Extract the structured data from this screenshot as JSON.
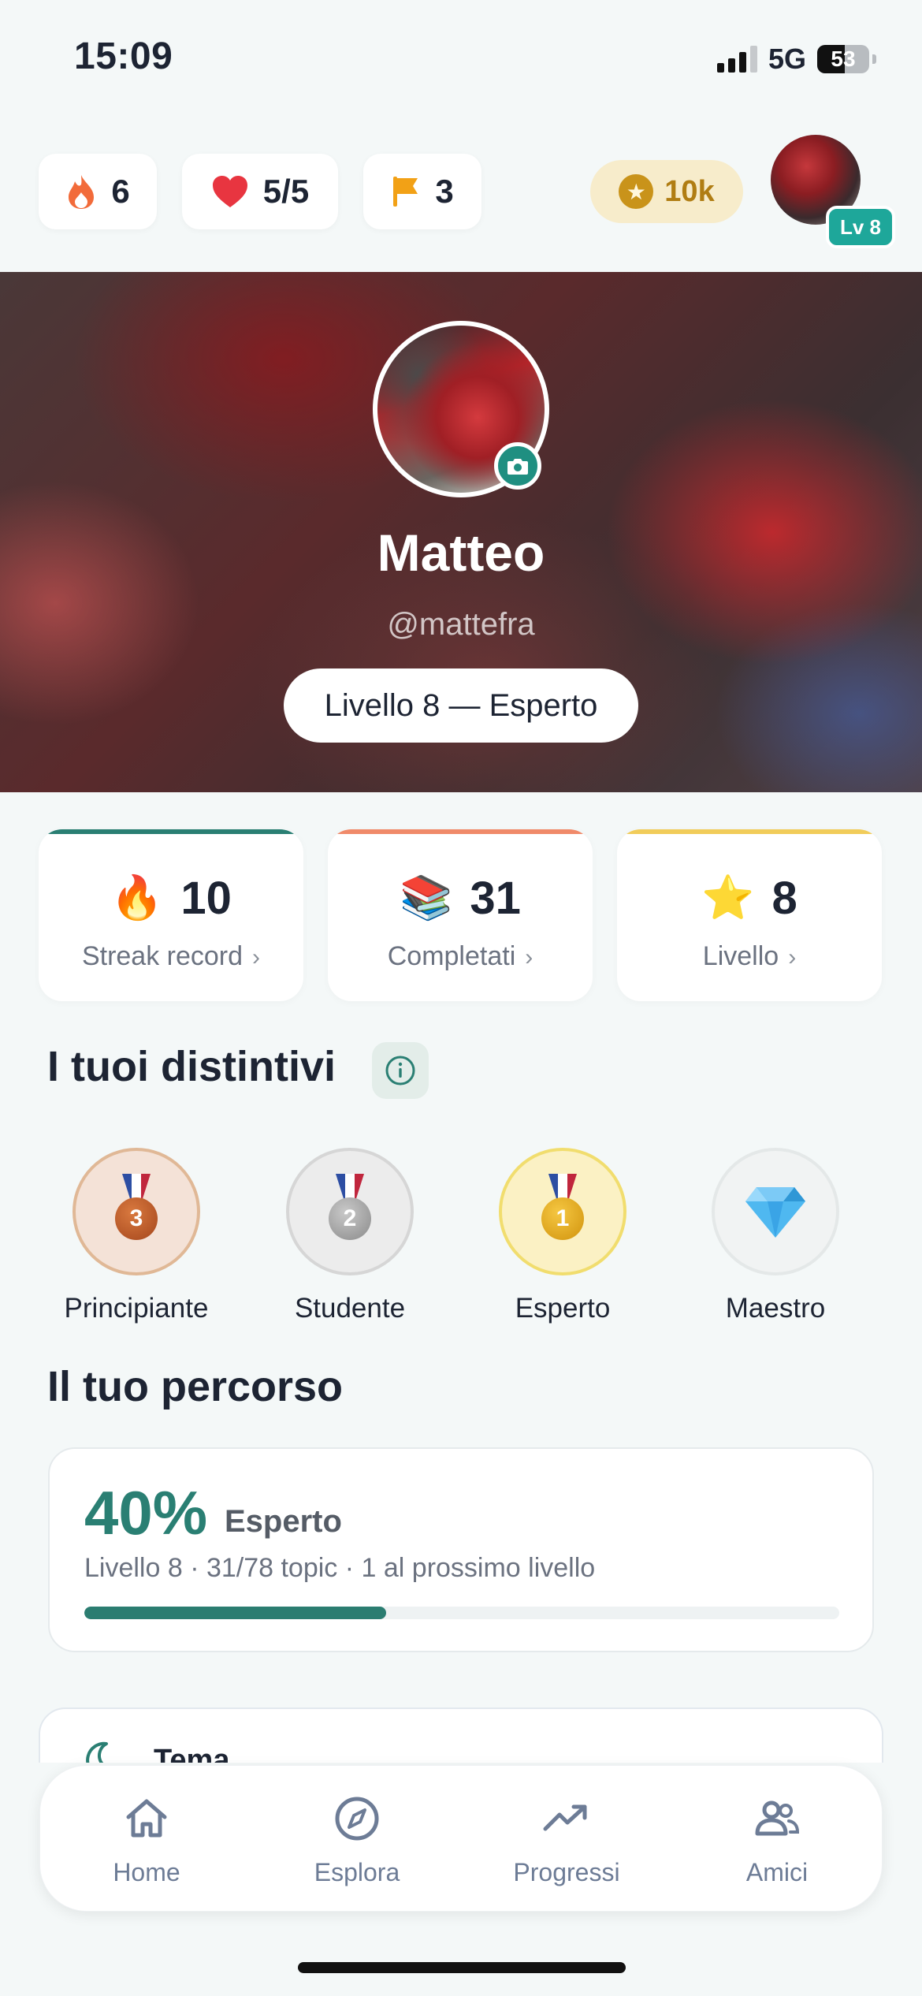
{
  "status_bar": {
    "time": "15:09",
    "network": "5G",
    "battery": "53",
    "battery_level": 0.53
  },
  "top_stats": {
    "streak": "6",
    "hearts": "5/5",
    "flags": "3",
    "coins": "10k",
    "avatar_level": "Lv 8"
  },
  "profile": {
    "name": "Matteo",
    "handle": "@mattefra",
    "level_pill": "Livello 8 — Esperto"
  },
  "stat_cards": [
    {
      "emoji": "🔥",
      "value": "10",
      "label": "Streak record",
      "accent": "#2a7f73"
    },
    {
      "emoji": "📚",
      "value": "31",
      "label": "Completati",
      "accent": "#f08a6a"
    },
    {
      "emoji": "⭐",
      "value": "8",
      "label": "Livello",
      "accent": "#f1cc5a"
    }
  ],
  "badges_section": {
    "title": "I tuoi distintivi",
    "items": [
      {
        "name": "Principiante",
        "number": "3",
        "icon": "bronze-medal-icon"
      },
      {
        "name": "Studente",
        "number": "2",
        "icon": "silver-medal-icon"
      },
      {
        "name": "Esperto",
        "number": "1",
        "icon": "gold-medal-icon"
      },
      {
        "name": "Maestro",
        "number": "",
        "icon": "diamond-icon"
      }
    ]
  },
  "journey": {
    "title": "Il tuo percorso",
    "percent": "40%",
    "percent_value": 0.4,
    "tier": "Esperto",
    "subtitle": "Livello 8 · 31/78 topic · 1 al prossimo livello"
  },
  "theme_row": {
    "label": "Tema",
    "icon": "moon-icon"
  },
  "tab_bar": [
    {
      "label": "Home",
      "icon": "home-icon"
    },
    {
      "label": "Esplora",
      "icon": "compass-icon"
    },
    {
      "label": "Progressi",
      "icon": "trend-up-icon"
    },
    {
      "label": "Amici",
      "icon": "users-icon"
    }
  ],
  "colors": {
    "accent": "#2a7f73",
    "coin": "#b07d13",
    "tab_inactive": "#6d7c96"
  }
}
